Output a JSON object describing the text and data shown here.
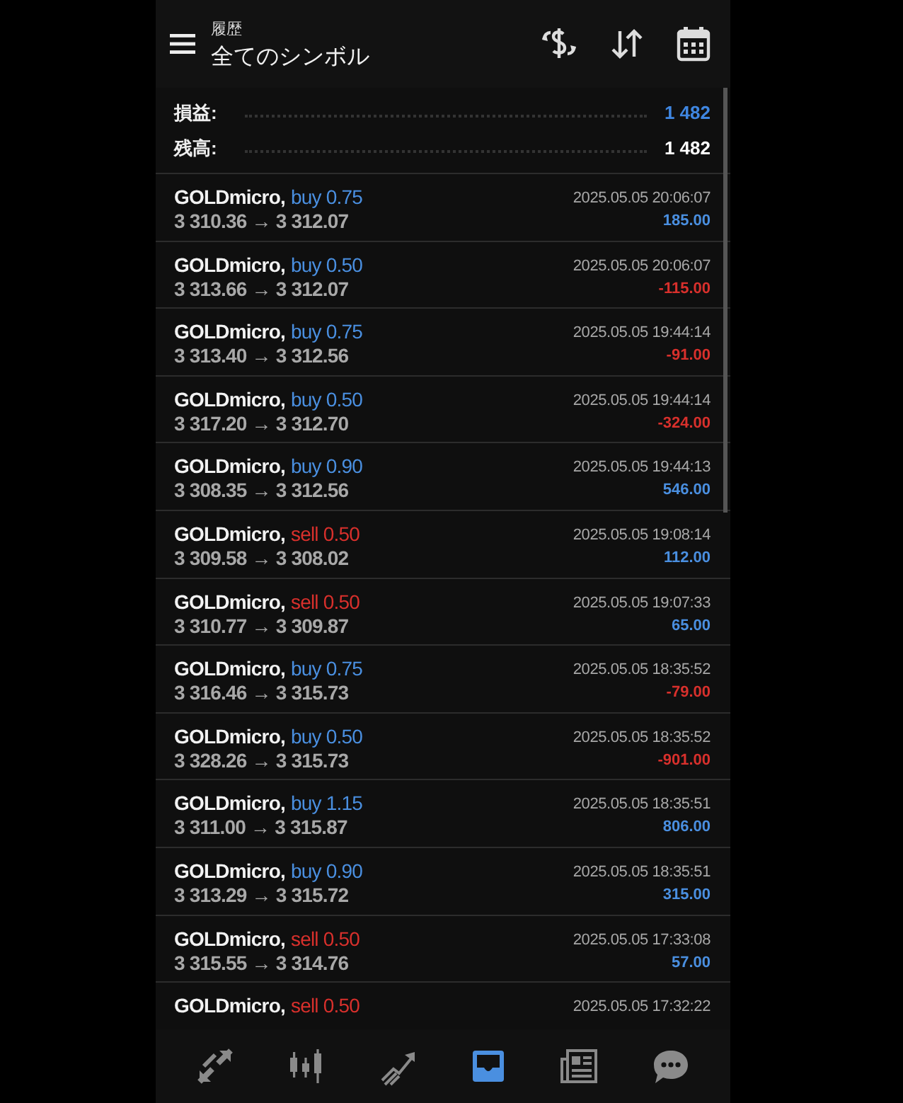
{
  "header": {
    "subtitle": "履歴",
    "title": "全てのシンボル"
  },
  "summary": [
    {
      "label": "損益:",
      "value": "1 482",
      "highlight": true
    },
    {
      "label": "残高:",
      "value": "1 482",
      "highlight": false
    }
  ],
  "deals": [
    {
      "symbol": "GOLDmicro,",
      "side": "buy",
      "volume": "0.75",
      "prices": "3 310.36 → 3 312.07",
      "time": "2025.05.05 20:06:07",
      "profit": "185.00",
      "loss": false
    },
    {
      "symbol": "GOLDmicro,",
      "side": "buy",
      "volume": "0.50",
      "prices": "3 313.66 → 3 312.07",
      "time": "2025.05.05 20:06:07",
      "profit": "-115.00",
      "loss": true
    },
    {
      "symbol": "GOLDmicro,",
      "side": "buy",
      "volume": "0.75",
      "prices": "3 313.40 → 3 312.56",
      "time": "2025.05.05 19:44:14",
      "profit": "-91.00",
      "loss": true
    },
    {
      "symbol": "GOLDmicro,",
      "side": "buy",
      "volume": "0.50",
      "prices": "3 317.20 → 3 312.70",
      "time": "2025.05.05 19:44:14",
      "profit": "-324.00",
      "loss": true
    },
    {
      "symbol": "GOLDmicro,",
      "side": "buy",
      "volume": "0.90",
      "prices": "3 308.35 → 3 312.56",
      "time": "2025.05.05 19:44:13",
      "profit": "546.00",
      "loss": false
    },
    {
      "symbol": "GOLDmicro,",
      "side": "sell",
      "volume": "0.50",
      "prices": "3 309.58 → 3 308.02",
      "time": "2025.05.05 19:08:14",
      "profit": "112.00",
      "loss": false
    },
    {
      "symbol": "GOLDmicro,",
      "side": "sell",
      "volume": "0.50",
      "prices": "3 310.77 → 3 309.87",
      "time": "2025.05.05 19:07:33",
      "profit": "65.00",
      "loss": false
    },
    {
      "symbol": "GOLDmicro,",
      "side": "buy",
      "volume": "0.75",
      "prices": "3 316.46 → 3 315.73",
      "time": "2025.05.05 18:35:52",
      "profit": "-79.00",
      "loss": true
    },
    {
      "symbol": "GOLDmicro,",
      "side": "buy",
      "volume": "0.50",
      "prices": "3 328.26 → 3 315.73",
      "time": "2025.05.05 18:35:52",
      "profit": "-901.00",
      "loss": true
    },
    {
      "symbol": "GOLDmicro,",
      "side": "buy",
      "volume": "1.15",
      "prices": "3 311.00 → 3 315.87",
      "time": "2025.05.05 18:35:51",
      "profit": "806.00",
      "loss": false
    },
    {
      "symbol": "GOLDmicro,",
      "side": "buy",
      "volume": "0.90",
      "prices": "3 313.29 → 3 315.72",
      "time": "2025.05.05 18:35:51",
      "profit": "315.00",
      "loss": false
    },
    {
      "symbol": "GOLDmicro,",
      "side": "sell",
      "volume": "0.50",
      "prices": "3 315.55 → 3 314.76",
      "time": "2025.05.05 17:33:08",
      "profit": "57.00",
      "loss": false
    },
    {
      "symbol": "GOLDmicro,",
      "side": "sell",
      "volume": "0.50",
      "time": "2025.05.05 17:32:22"
    }
  ],
  "nav": [
    {
      "selected": false
    },
    {
      "selected": false
    },
    {
      "selected": false
    },
    {
      "selected": true
    },
    {
      "selected": false
    },
    {
      "selected": false
    }
  ]
}
